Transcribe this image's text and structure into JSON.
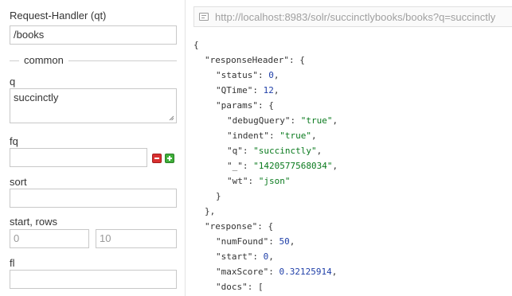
{
  "form": {
    "request_handler": {
      "label": "Request-Handler (qt)",
      "value": "/books"
    },
    "common_legend": "common",
    "q": {
      "label": "q",
      "value": "succinctly"
    },
    "fq": {
      "label": "fq",
      "value": ""
    },
    "sort": {
      "label": "sort",
      "value": ""
    },
    "start_rows": {
      "label": "start, rows",
      "start_placeholder": "0",
      "rows_placeholder": "10"
    },
    "fl": {
      "label": "fl",
      "value": ""
    }
  },
  "url": "http://localhost:8983/solr/succinctlybooks/books?q=succinctly",
  "response_lines": [
    {
      "indent": 0,
      "key": "",
      "value": "{",
      "vtype": "plain"
    },
    {
      "indent": 1,
      "key": "\"responseHeader\"",
      "value": ": {",
      "vtype": "plain"
    },
    {
      "indent": 2,
      "key": "\"status\"",
      "value": "0",
      "vtype": "number",
      "tail": ","
    },
    {
      "indent": 2,
      "key": "\"QTime\"",
      "value": "12",
      "vtype": "number",
      "tail": ","
    },
    {
      "indent": 2,
      "key": "\"params\"",
      "value": ": {",
      "vtype": "plain"
    },
    {
      "indent": 3,
      "key": "\"debugQuery\"",
      "value": "\"true\"",
      "vtype": "string",
      "tail": ","
    },
    {
      "indent": 3,
      "key": "\"indent\"",
      "value": "\"true\"",
      "vtype": "string",
      "tail": ","
    },
    {
      "indent": 3,
      "key": "\"q\"",
      "value": "\"succinctly\"",
      "vtype": "string",
      "tail": ","
    },
    {
      "indent": 3,
      "key": "\"_\"",
      "value": "\"1420577568034\"",
      "vtype": "string",
      "tail": ","
    },
    {
      "indent": 3,
      "key": "\"wt\"",
      "value": "\"json\"",
      "vtype": "string"
    },
    {
      "indent": 2,
      "key": "",
      "value": "}",
      "vtype": "plain"
    },
    {
      "indent": 1,
      "key": "",
      "value": "},",
      "vtype": "plain"
    },
    {
      "indent": 1,
      "key": "\"response\"",
      "value": ": {",
      "vtype": "plain"
    },
    {
      "indent": 2,
      "key": "\"numFound\"",
      "value": "50",
      "vtype": "number",
      "tail": ","
    },
    {
      "indent": 2,
      "key": "\"start\"",
      "value": "0",
      "vtype": "number",
      "tail": ","
    },
    {
      "indent": 2,
      "key": "\"maxScore\"",
      "value": "0.32125914",
      "vtype": "number",
      "tail": ","
    },
    {
      "indent": 2,
      "key": "\"docs\"",
      "value": ": [",
      "vtype": "plain"
    }
  ],
  "colors": {
    "string": "#0a7a1e",
    "number": "#1f3fa8",
    "text": "#333333"
  }
}
